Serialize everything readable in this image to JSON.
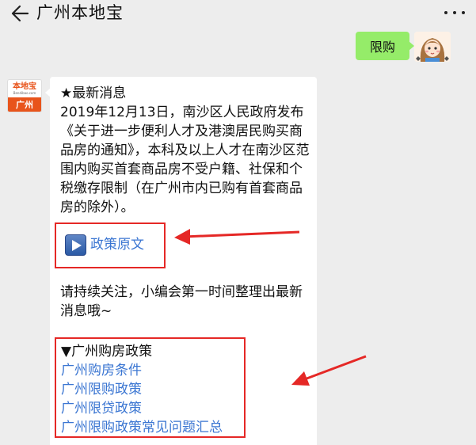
{
  "header": {
    "title": "广州本地宝",
    "back_icon": "back-arrow-icon",
    "more_icon": "more-dots-icon"
  },
  "outgoing": {
    "text": "限购"
  },
  "bot": {
    "avatar_logo_text": "本地宝",
    "avatar_logo_sub": "Bendibao.com",
    "avatar_city": "广州"
  },
  "message": {
    "news_heading": "★最新消息",
    "news_body": "2019年12月13日，南沙区人民政府发布《关于进一步便利人才及港澳居民购买商品房的通知》，本科及以上人才在南沙区范围内购买首套商品房不受户籍、社保和个税缴存限制（在广州市内已购有首套商品房的除外）。",
    "policy_link": "政策原文",
    "policy_icon": "play-video-icon",
    "follow_text": "请持续关注，小编会第一时间整理出最新消息哦~",
    "policy_section_heading": "▼广州购房政策",
    "policy_links": [
      "广州购房条件",
      "广州限购政策",
      "广州限贷政策",
      "广州限购政策常见问题汇总"
    ]
  },
  "colors": {
    "background": "#ededed",
    "outgoing_bubble": "#95ec69",
    "link": "#3b76d2",
    "highlight_box": "#e52826",
    "brand": "#e8541b"
  }
}
